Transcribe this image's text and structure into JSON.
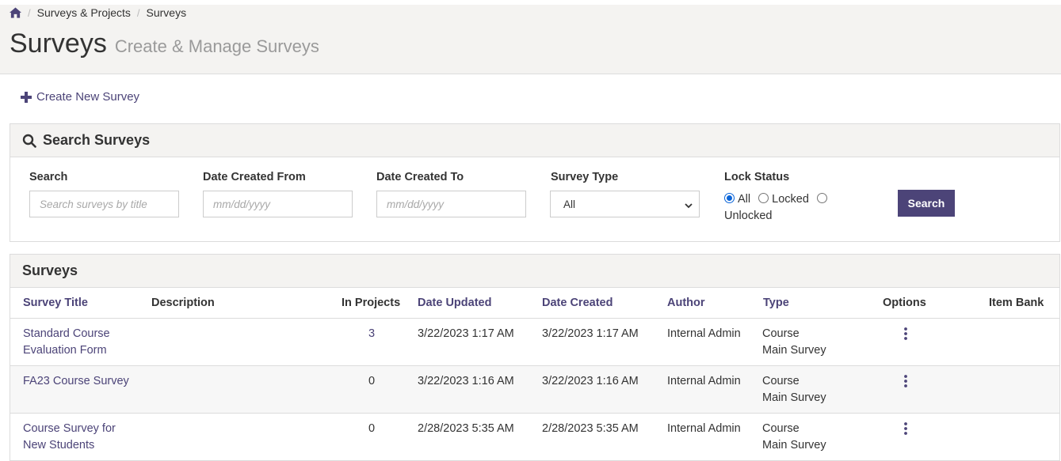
{
  "breadcrumb": {
    "items": [
      "Surveys & Projects",
      "Surveys"
    ]
  },
  "header": {
    "title": "Surveys",
    "subtitle": "Create & Manage Surveys"
  },
  "actions": {
    "create_label": "Create New Survey"
  },
  "search_panel": {
    "title": "Search Surveys",
    "search_label": "Search",
    "search_placeholder": "Search surveys by title",
    "date_from_label": "Date Created From",
    "date_from_placeholder": "mm/dd/yyyy",
    "date_to_label": "Date Created To",
    "date_to_placeholder": "mm/dd/yyyy",
    "type_label": "Survey Type",
    "type_value": "All",
    "lock_label": "Lock Status",
    "lock_options": [
      "All",
      "Locked",
      "Unlocked"
    ],
    "lock_selected": "All",
    "button_label": "Search"
  },
  "surveys_panel": {
    "title": "Surveys",
    "columns": [
      "Survey Title",
      "Description",
      "In Projects",
      "Date Updated",
      "Date Created",
      "Author",
      "Type",
      "Options",
      "Item Bank"
    ],
    "rows": [
      {
        "title_line1": "Standard Course",
        "title_line2": "Evaluation Form",
        "description": "",
        "in_projects": "3",
        "date_updated": "3/22/2023 1:17 AM",
        "date_created": "3/22/2023 1:17 AM",
        "author": "Internal Admin",
        "type_line1": "Course",
        "type_line2": "Main Survey"
      },
      {
        "title_line1": "FA23 Course Survey",
        "title_line2": "",
        "description": "",
        "in_projects": "0",
        "date_updated": "3/22/2023 1:16 AM",
        "date_created": "3/22/2023 1:16 AM",
        "author": "Internal Admin",
        "type_line1": "Course",
        "type_line2": "Main Survey"
      },
      {
        "title_line1": "Course Survey for",
        "title_line2": "New Students",
        "description": "",
        "in_projects": "0",
        "date_updated": "2/28/2023 5:35 AM",
        "date_created": "2/28/2023 5:35 AM",
        "author": "Internal Admin",
        "type_line1": "Course",
        "type_line2": "Main Survey"
      }
    ]
  },
  "colors": {
    "accent": "#4c4478",
    "header_bg": "#f4f3f1",
    "radio": "#0a64d8"
  },
  "icons": {
    "home": "home-icon",
    "plus": "plus-icon",
    "search": "search-icon",
    "kebab": "kebab-menu-icon"
  }
}
